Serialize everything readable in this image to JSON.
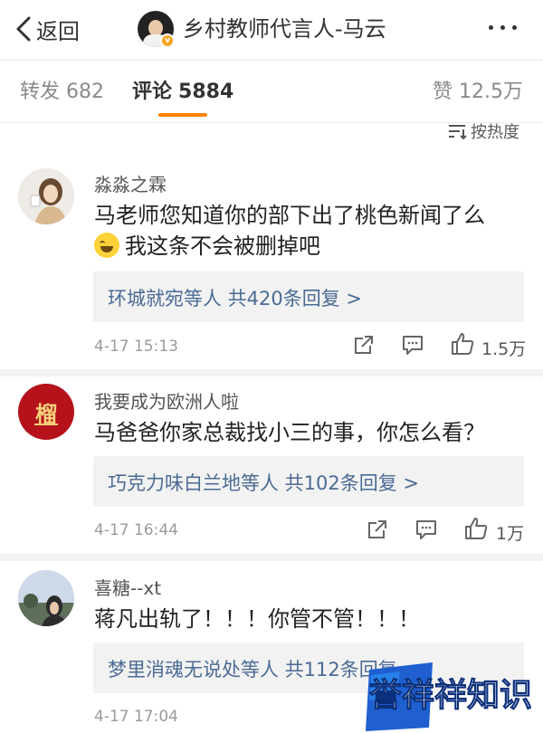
{
  "nav": {
    "back_label": "返回",
    "title": "乡村教师代言人-马云"
  },
  "tabs": {
    "repost_label": "转发",
    "repost_count": "682",
    "comment_label": "评论",
    "comment_count": "5884",
    "like_label": "赞",
    "like_count": "12.5万"
  },
  "sort_label": "按热度",
  "colors": {
    "accent": "#ff8200",
    "link": "#4b6b94",
    "reply_bg": "#f2f2f2"
  },
  "comments": [
    {
      "username": "淼淼之霖",
      "text_line1": "马老师您知道你的部下出了桃色新闻了么",
      "text_line2": "我这条不会被删掉吧",
      "emoji": "laughing-crying-emoji",
      "reply_summary": "环城就宛等人  共420条回复 >",
      "time": "4-17 15:13",
      "likes": "1.5万"
    },
    {
      "username": "我要成为欧洲人啦",
      "text_line1": "马爸爸你家总裁找小三的事，你怎么看？",
      "avatar_text": "榴",
      "reply_summary": "巧克力味白兰地等人  共102条回复 >",
      "time": "4-17 16:44",
      "likes": "1万"
    },
    {
      "username": "喜糖--xt",
      "text_line1": "蒋凡出轨了！！！你管不管！！！",
      "reply_summary": "梦里消魂无说处等人  共112条回复",
      "time": "4-17 17:04"
    }
  ],
  "watermark": {
    "text": "誉祥祥知识"
  }
}
